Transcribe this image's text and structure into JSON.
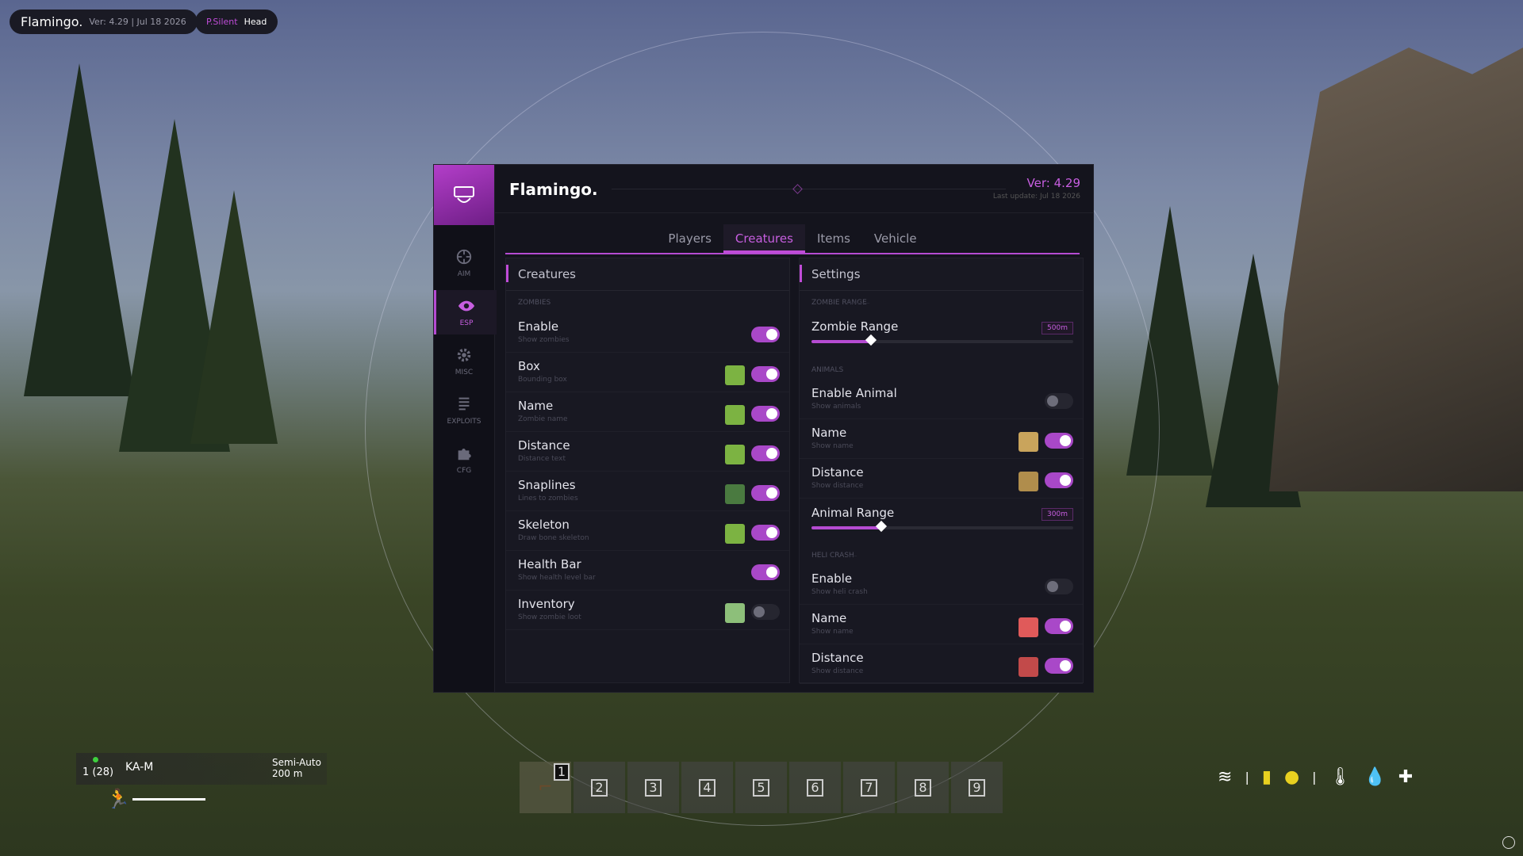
{
  "top_bar": {
    "brand": "Flamingo.",
    "version_info": "Ver: 4.29  |  Jul 18 2026",
    "aim_mode": "P.Silent",
    "aim_target": "Head"
  },
  "sidebar": {
    "items": [
      {
        "label": "AIM",
        "icon": "crosshair-icon"
      },
      {
        "label": "ESP",
        "icon": "eye-icon"
      },
      {
        "label": "MISC",
        "icon": "gear-icon"
      },
      {
        "label": "EXPLOITS",
        "icon": "list-icon"
      },
      {
        "label": "CFG",
        "icon": "puzzle-icon"
      }
    ],
    "active": "ESP"
  },
  "header": {
    "title": "Flamingo.",
    "version": "Ver: 4.29",
    "last_update": "Last update: Jul 18 2026"
  },
  "tabs": [
    "Players",
    "Creatures",
    "Items",
    "Vehicle"
  ],
  "active_tab": "Creatures",
  "creatures": {
    "title": "Creatures",
    "section": "ZOMBIES",
    "rows": [
      {
        "label": "Enable",
        "sub": "Show zombies",
        "on": true,
        "color": null
      },
      {
        "label": "Box",
        "sub": "Bounding box",
        "on": true,
        "color": "#7cb342"
      },
      {
        "label": "Name",
        "sub": "Zombie name",
        "on": true,
        "color": "#7cb342"
      },
      {
        "label": "Distance",
        "sub": "Distance text",
        "on": true,
        "color": "#7cb342"
      },
      {
        "label": "Snaplines",
        "sub": "Lines to zombies",
        "on": true,
        "color": "#4a7a40"
      },
      {
        "label": "Skeleton",
        "sub": "Draw bone skeleton",
        "on": true,
        "color": "#7cb342"
      },
      {
        "label": "Health Bar",
        "sub": "Show health level bar",
        "on": true,
        "color": null
      },
      {
        "label": "Inventory",
        "sub": "Show zombie loot",
        "on": false,
        "color": "#8dbf7a"
      }
    ]
  },
  "settings": {
    "title": "Settings",
    "zombie_range": {
      "section": "ZOMBIE RANGE",
      "label": "Zombie Range",
      "value": "500m",
      "fraction": 0.23
    },
    "animals_section": "ANIMALS",
    "animal_rows": [
      {
        "label": "Enable Animal",
        "sub": "Show animals",
        "on": false,
        "color": null
      },
      {
        "label": "Name",
        "sub": "Show name",
        "on": true,
        "color": "#c9a45c"
      },
      {
        "label": "Distance",
        "sub": "Show distance",
        "on": true,
        "color": "#b08d4c"
      }
    ],
    "animal_range": {
      "label": "Animal Range",
      "value": "300m",
      "fraction": 0.27
    },
    "heli_section": "HELI CRASH",
    "heli_rows": [
      {
        "label": "Enable",
        "sub": "Show heli crash",
        "on": false,
        "color": null
      },
      {
        "label": "Name",
        "sub": "Show name",
        "on": true,
        "color": "#e05a5a"
      },
      {
        "label": "Distance",
        "sub": "Show distance",
        "on": true,
        "color": "#c24a4a"
      }
    ]
  },
  "hud": {
    "ammo": "1 (28)",
    "weapon": "KA-M",
    "fire_mode": "Semi-Auto",
    "zeroing": "200 m",
    "hotbar": [
      "1",
      "2",
      "3",
      "4",
      "5",
      "6",
      "7",
      "8",
      "9"
    ]
  }
}
